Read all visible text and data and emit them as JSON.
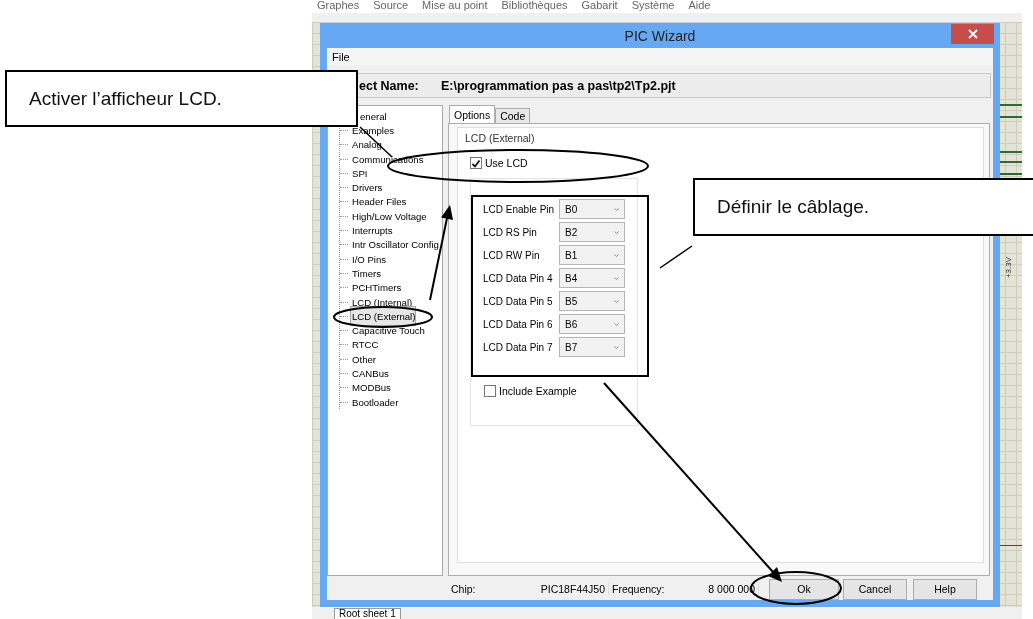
{
  "app_menu": [
    "Graphes",
    "Source",
    "Mise au point",
    "Bibliothèques",
    "Gabarit",
    "Système",
    "Aide"
  ],
  "window": {
    "title": "PIC Wizard"
  },
  "menu": [
    "File"
  ],
  "project": {
    "label": "ect Name:",
    "value": "E:\\programmation pas a pas\\tp2\\Tp2.pjt"
  },
  "tree": [
    {
      "label": "eneral",
      "selected": false
    },
    {
      "label": "Examples",
      "selected": false
    },
    {
      "label": "Analog",
      "selected": false
    },
    {
      "label": "Communications",
      "selected": false
    },
    {
      "label": "SPI",
      "selected": false
    },
    {
      "label": "Drivers",
      "selected": false
    },
    {
      "label": "Header Files",
      "selected": false
    },
    {
      "label": "High/Low Voltage",
      "selected": false
    },
    {
      "label": "Interrupts",
      "selected": false
    },
    {
      "label": "Intr Oscillator Config",
      "selected": false
    },
    {
      "label": "I/O Pins",
      "selected": false
    },
    {
      "label": "Timers",
      "selected": false
    },
    {
      "label": "PCHTimers",
      "selected": false
    },
    {
      "label": "LCD (Internal)",
      "selected": false
    },
    {
      "label": "LCD (External)",
      "selected": true
    },
    {
      "label": "Capacitive Touch",
      "selected": false
    },
    {
      "label": "RTCC",
      "selected": false
    },
    {
      "label": "Other",
      "selected": false
    },
    {
      "label": "CANBus",
      "selected": false
    },
    {
      "label": "MODBus",
      "selected": false
    },
    {
      "label": "Bootloader",
      "selected": false
    }
  ],
  "tabs": [
    {
      "label": "Options",
      "selected": true
    },
    {
      "label": "Code",
      "selected": false
    }
  ],
  "group_label": "LCD (External)",
  "use_lcd": {
    "label": "Use LCD",
    "checked": true
  },
  "pins": [
    {
      "label": "LCD Enable Pin",
      "value": "B0"
    },
    {
      "label": "LCD RS Pin",
      "value": "B2"
    },
    {
      "label": "LCD RW Pin",
      "value": "B1"
    },
    {
      "label": "LCD Data Pin 4",
      "value": "B4"
    },
    {
      "label": "LCD Data Pin 5",
      "value": "B5"
    },
    {
      "label": "LCD Data Pin 6",
      "value": "B6"
    },
    {
      "label": "LCD Data Pin 7",
      "value": "B7"
    }
  ],
  "include_example": {
    "label": "Include Example",
    "checked": false
  },
  "status": {
    "chip_label": "Chip:",
    "chip": "PIC18F44J50",
    "frequency_label": "Frequency:",
    "frequency": "8 000 000"
  },
  "buttons": [
    "Ok",
    "Cancel",
    "Help"
  ],
  "schematic": {
    "net_label": "+3.3V"
  },
  "sheet_tab": "Root sheet 1",
  "annotations": [
    {
      "text": "Activer l’afficheur LCD."
    },
    {
      "text": "Définir le câblage."
    }
  ]
}
